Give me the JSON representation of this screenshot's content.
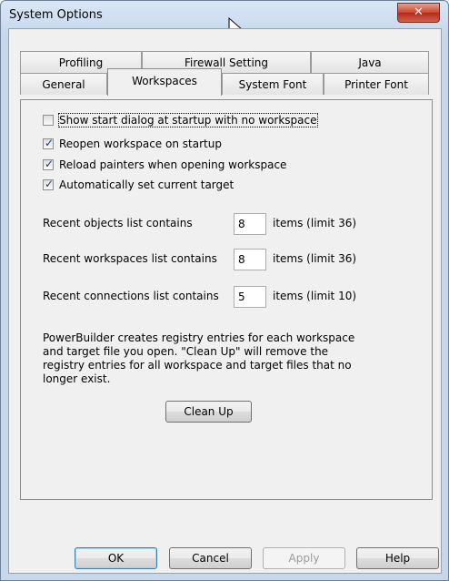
{
  "window": {
    "title": "System Options",
    "close_glyph": "✕"
  },
  "tabs_row1": [
    {
      "label": "Profiling"
    },
    {
      "label": "Firewall Setting"
    },
    {
      "label": "Java"
    }
  ],
  "tabs_row2": [
    {
      "label": "General"
    },
    {
      "label": "Workspaces",
      "active": true
    },
    {
      "label": "System Font"
    },
    {
      "label": "Printer Font"
    }
  ],
  "checkboxes": [
    {
      "label": "Show start dialog at startup with no workspace",
      "checked": false
    },
    {
      "label": "Reopen workspace on startup",
      "checked": true
    },
    {
      "label": "Reload painters when opening workspace",
      "checked": true
    },
    {
      "label": "Automatically set current target",
      "checked": true
    }
  ],
  "fields": [
    {
      "label": "Recent objects list contains",
      "value": "8",
      "suffix": "items (limit 36)"
    },
    {
      "label": "Recent workspaces list contains",
      "value": "8",
      "suffix": "items (limit 36)"
    },
    {
      "label": "Recent connections list contains",
      "value": "5",
      "suffix": "items (limit 10)"
    }
  ],
  "description": "PowerBuilder creates registry entries for each workspace and target file you open. \"Clean Up\" will remove the registry entries for all workspace and target files that no longer exist.",
  "buttons": {
    "clean_up": "Clean Up",
    "ok": "OK",
    "cancel": "Cancel",
    "apply": "Apply",
    "help": "Help"
  }
}
